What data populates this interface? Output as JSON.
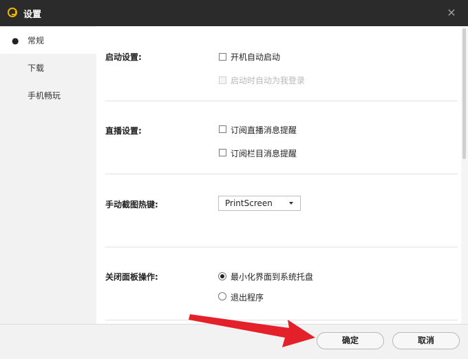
{
  "window": {
    "title": "设置",
    "close_glyph": "✕"
  },
  "sidebar": {
    "items": [
      {
        "label": "常规",
        "active": true,
        "bullet": "●"
      },
      {
        "label": "下载"
      },
      {
        "label": "手机畅玩"
      }
    ]
  },
  "sections": {
    "startup": {
      "label": "启动设置:",
      "options": [
        {
          "label": "开机自动启动",
          "checked": false,
          "enabled": true
        },
        {
          "label": "启动时自动为我登录",
          "checked": false,
          "enabled": false
        }
      ]
    },
    "live": {
      "label": "直播设置:",
      "options": [
        {
          "label": "订阅直播消息提醒",
          "checked": false
        },
        {
          "label": "订阅栏目消息提醒",
          "checked": false
        }
      ]
    },
    "hotkey": {
      "label": "手动截图热键:",
      "value": "PrintScreen"
    },
    "close_action": {
      "label": "关闭面板操作:",
      "options": [
        {
          "label": "最小化界面到系统托盘",
          "selected": true
        },
        {
          "label": "退出程序",
          "selected": false
        }
      ]
    }
  },
  "footer": {
    "confirm_label": "确定",
    "cancel_label": "取消"
  },
  "colors": {
    "titlebar": "#2b2b2b",
    "logo": "#f0b400",
    "arrow": "#e4202a",
    "sidebar_bg": "#f2f2f2"
  },
  "icons": {
    "logo": "app-logo-icon",
    "close": "close-icon",
    "dropdown": "chevron-down-icon",
    "arrow": "red-arrow-annotation"
  }
}
